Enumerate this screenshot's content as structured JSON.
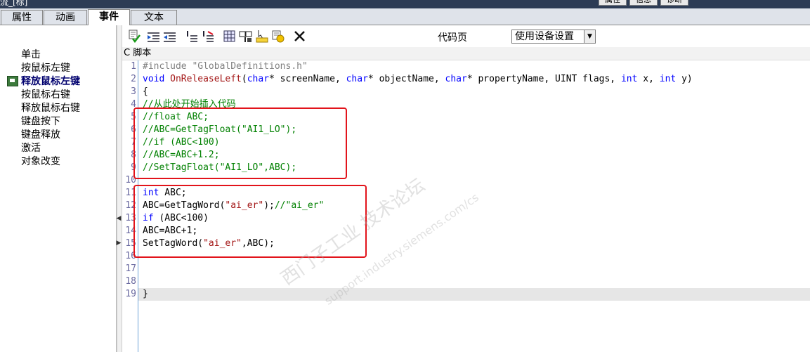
{
  "window": {
    "title_fragment": "流_[标]",
    "right_tabs": [
      "属性",
      "信息",
      "诊断"
    ]
  },
  "tabs": [
    "属性",
    "动画",
    "事件",
    "文本"
  ],
  "active_tab": "事件",
  "events": [
    "单击",
    "按鼠标左键",
    "释放鼠标左键",
    "按鼠标右键",
    "释放鼠标右键",
    "键盘按下",
    "键盘释放",
    "激活",
    "对象改变"
  ],
  "selected_event": "释放鼠标左键",
  "toolbar": {
    "icons": [
      "check-syntax-icon",
      "indent-icon",
      "outdent-icon",
      "comment-icon",
      "uncomment-icon",
      "tag-list-icon",
      "function-list-icon",
      "script-list-icon",
      "object-list-icon",
      "delete-icon"
    ],
    "code_page_label": "代码页",
    "device_setting": "使用设备设置"
  },
  "script_header": "C  脚本",
  "code": {
    "line_numbers": [
      "1",
      "2",
      "3",
      "4",
      "5",
      "6",
      "7",
      "8",
      "9",
      "10",
      "11",
      "12",
      "13",
      "14",
      "15",
      "16",
      "17",
      "18",
      "19"
    ],
    "l1": "#include \"GlobalDefinitions.h\"",
    "l2_void": "void",
    "l2_fn": "OnReleaseLeft",
    "l2_p1": "(",
    "l2_char": "char",
    "l2_p2": "* screenName, ",
    "l2_p3": "* objectName, ",
    "l2_p4": "* propertyName, UINT flags, ",
    "l2_int": "int",
    "l2_p5": " x, ",
    "l2_p6": " y)",
    "l3": "{",
    "l4": "//从此处开始插入代码",
    "l5": "//float ABC;",
    "l6": "//ABC=GetTagFloat(\"AI1_LO\");",
    "l7": "//if (ABC<100)",
    "l8": "//ABC=ABC+1.2;",
    "l9": "//SetTagFloat(\"AI1_LO\",ABC);",
    "l11_kw": "int",
    "l11_rest": " ABC;",
    "l12_a": "ABC=GetTagWord(",
    "l12_s": "\"ai_er\"",
    "l12_b": ");",
    "l12_c": "//\"ai_er\"",
    "l13_kw": "if",
    "l13_rest": " (ABC<100)",
    "l14": "ABC=ABC+1;",
    "l15_a": "SetTagWord(",
    "l15_s": "\"ai_er\"",
    "l15_b": ",ABC);",
    "l19": "}"
  },
  "watermark": {
    "line1": "西门子工业 技术论坛",
    "line2": "support.industry.siemens.com/cs"
  },
  "colors": {
    "keyword": "#0000ff",
    "function": "#a31515",
    "comment": "#008000",
    "annotation_box": "#e2141b"
  }
}
